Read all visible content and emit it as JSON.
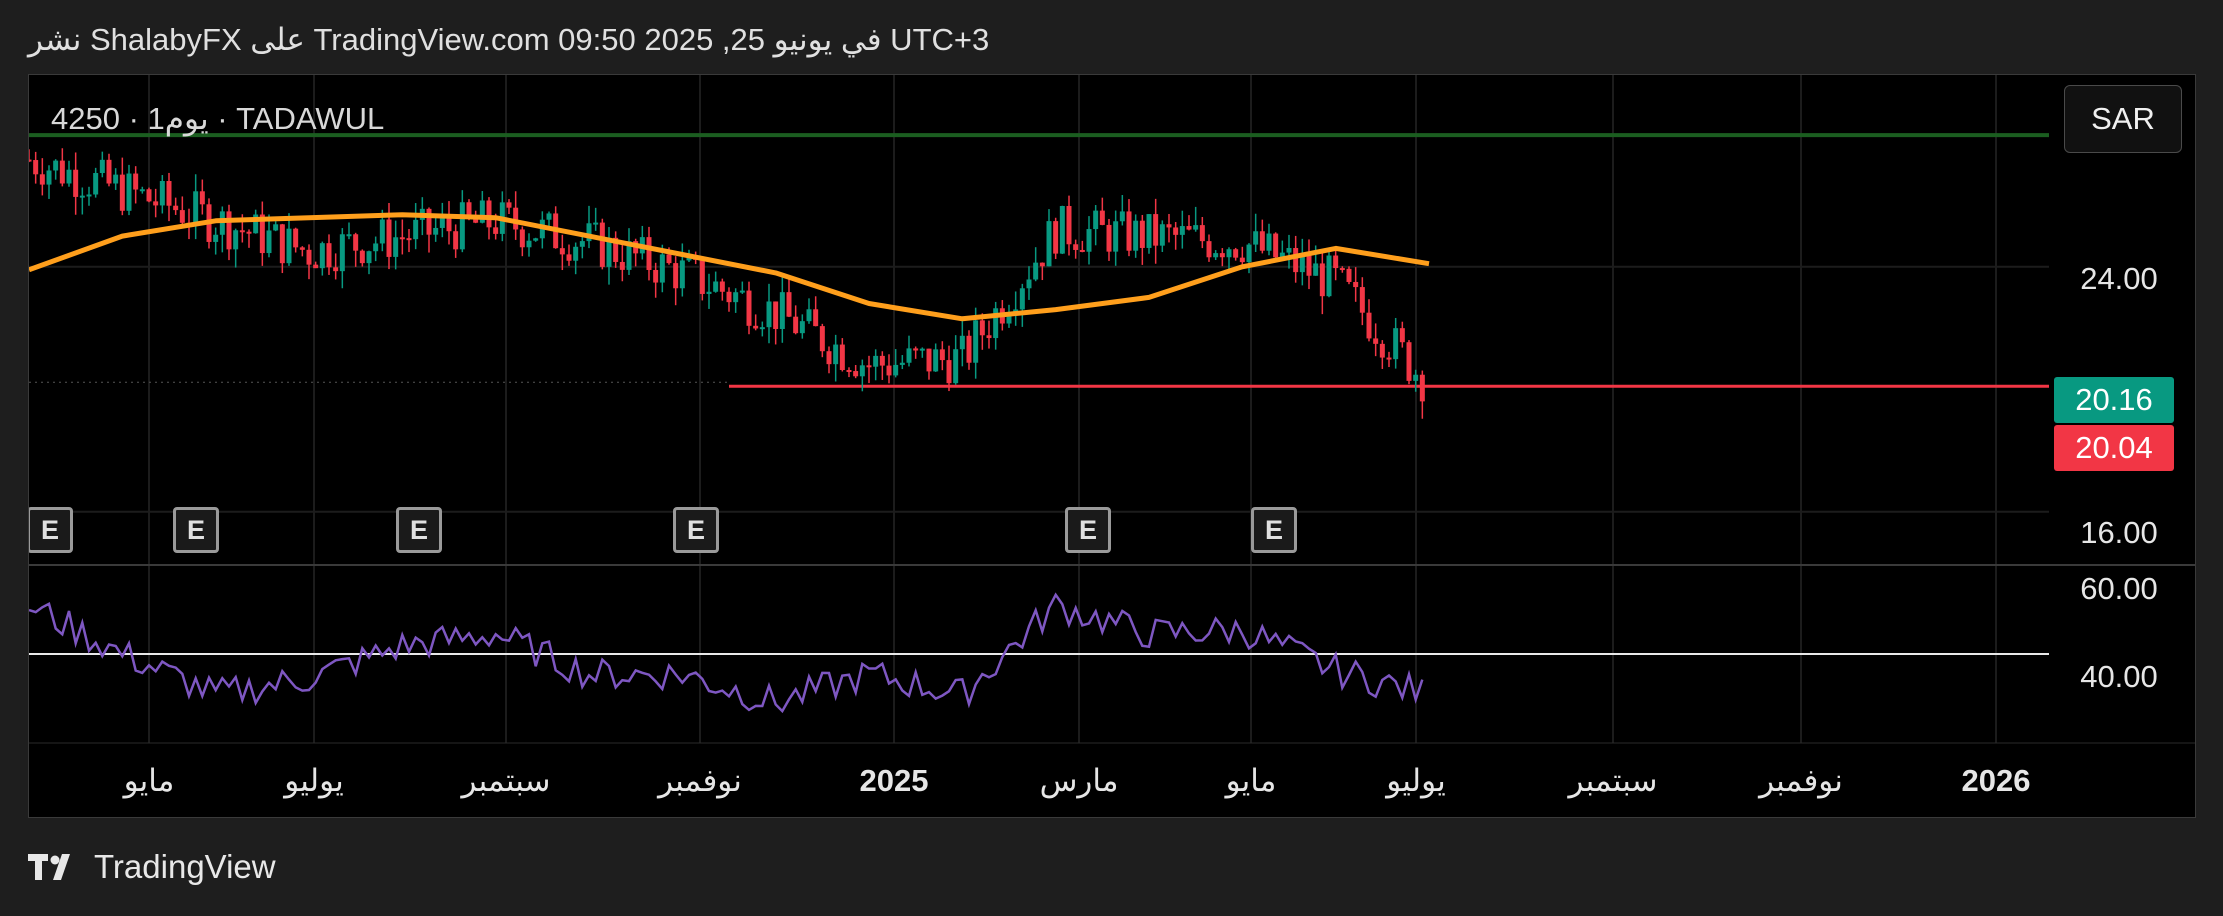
{
  "header": {
    "published_text": "نشر ShalabyFX على TradingView.com 09:50 2025 ,25 في يونيو UTC+3"
  },
  "symbol": {
    "label": "4250 · 1يوم · TADAWUL"
  },
  "toolbar": {
    "currency_label": "SAR"
  },
  "price_tags": {
    "last": "20.16",
    "bid": "20.04"
  },
  "price_axis": [
    "24.00",
    "16.00"
  ],
  "rsi_axis": [
    "60.00",
    "40.00"
  ],
  "earnings_marker_label": "E",
  "time_axis": [
    "مايو",
    "يوليو",
    "سبتمبر",
    "نوفمبر",
    "2025",
    "مارس",
    "مايو",
    "يوليو",
    "سبتمبر",
    "نوفمبر",
    "2026"
  ],
  "footer": {
    "brand": "TradingView"
  },
  "colors": {
    "background": "#000000",
    "frame": "#1e1e1e",
    "ma_line": "#ff9f1c",
    "resistance_line": "#1b5e20",
    "support_line": "#f23645",
    "rsi_line": "#7e57c2",
    "up_candle": "#089981",
    "down_candle": "#f23645"
  },
  "chart_data": {
    "type": "line",
    "x": [
      "2024-03",
      "2024-04",
      "2024-05",
      "2024-06",
      "2024-07",
      "2024-08",
      "2024-09",
      "2024-10",
      "2024-11",
      "2024-12",
      "2025-01",
      "2025-02",
      "2025-03",
      "2025-04",
      "2025-05",
      "2025-06"
    ],
    "series": [
      {
        "values": [
          27.5,
          26.5,
          25.5,
          24.5,
          25.0,
          25.5,
          24.8,
          23.8,
          22.5,
          20.8,
          21.0,
          25.2,
          25.0,
          24.8,
          23.5,
          20.16
        ]
      }
    ],
    "indicators": {
      "moving_average": [
        23.9,
        25.0,
        25.5,
        25.6,
        25.7,
        25.6,
        25.0,
        24.4,
        23.8,
        22.8,
        22.3,
        22.6,
        23.0,
        24.0,
        24.6,
        24.1
      ],
      "rsi": [
        62,
        50,
        40,
        44,
        52,
        55,
        45,
        45,
        38,
        45,
        40,
        62,
        55,
        56,
        46,
        40
      ]
    },
    "horizontal_levels": {
      "resistance": 28.3,
      "support": 20.1
    },
    "y_ticks": [
      "24.00",
      "16.00"
    ],
    "rsi_ticks": [
      "60.00",
      "40.00"
    ],
    "grid": true,
    "legend": "none"
  }
}
